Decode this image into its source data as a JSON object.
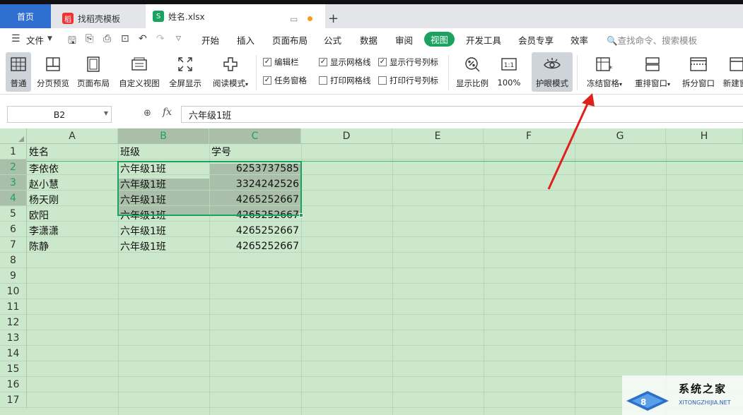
{
  "tabs": {
    "home": "首页",
    "template": "找稻壳模板",
    "file": "姓名.xlsx",
    "add": "+"
  },
  "menu": {
    "file": "文件",
    "items": [
      "开始",
      "插入",
      "页面布局",
      "公式",
      "数据",
      "审阅",
      "视图",
      "开发工具",
      "会员专享",
      "效率"
    ],
    "active": "视图",
    "search_placeholder": "查找命令、搜索模板"
  },
  "ribbon": {
    "buttons": [
      {
        "label": "普通",
        "icon": "grid-icon"
      },
      {
        "label": "分页预览",
        "icon": "page-break-icon"
      },
      {
        "label": "页面布局",
        "icon": "page-layout-icon"
      },
      {
        "label": "自定义视图",
        "icon": "custom-view-icon"
      },
      {
        "label": "全屏显示",
        "icon": "fullscreen-icon"
      },
      {
        "label": "阅读模式",
        "icon": "reading-mode-icon"
      },
      {
        "label": "显示比例",
        "icon": "zoom-ratio-icon"
      },
      {
        "label": "100%",
        "icon": "one-to-one-icon"
      },
      {
        "label": "护眼模式",
        "icon": "eye-icon"
      },
      {
        "label": "冻结窗格",
        "icon": "freeze-panes-icon"
      },
      {
        "label": "重排窗口",
        "icon": "arrange-window-icon"
      },
      {
        "label": "拆分窗口",
        "icon": "split-window-icon"
      },
      {
        "label": "新建窗",
        "icon": "new-window-icon"
      }
    ],
    "checkboxes": [
      {
        "label": "编辑栏",
        "checked": true
      },
      {
        "label": "任务窗格",
        "checked": true
      },
      {
        "label": "显示网格线",
        "checked": true
      },
      {
        "label": "打印网格线",
        "checked": false
      },
      {
        "label": "显示行号列标",
        "checked": true
      },
      {
        "label": "打印行号列标",
        "checked": false
      }
    ]
  },
  "formula_bar": {
    "name_box": "B2",
    "fx": "fx",
    "value": "六年级1班"
  },
  "sheet": {
    "columns": [
      "A",
      "B",
      "C",
      "D",
      "E",
      "F",
      "G",
      "H"
    ],
    "rows": [
      "1",
      "2",
      "3",
      "4",
      "5",
      "6",
      "7",
      "8",
      "9",
      "10",
      "11",
      "12",
      "13",
      "14",
      "15",
      "16",
      "17"
    ],
    "cells": [
      [
        "姓名",
        "班级",
        "学号"
      ],
      [
        "李依依",
        "六年级1班",
        "6253737585"
      ],
      [
        "赵小慧",
        "六年级1班",
        "3324242526"
      ],
      [
        "杨天刚",
        "六年级1班",
        "4265252667"
      ],
      [
        "欧阳",
        "六年级1班",
        "4265252667"
      ],
      [
        "李潇潇",
        "六年级1班",
        "4265252667"
      ],
      [
        "陈静",
        "六年级1班",
        "4265252667"
      ]
    ]
  },
  "watermark": {
    "text": "系统之家",
    "sub": "XITONGZHIJIA.NET"
  },
  "colors": {
    "sheet_bg": "#cce8cc",
    "accent": "#1aa260",
    "home_tab": "#2f6fd0",
    "arrow": "#e0201a"
  }
}
